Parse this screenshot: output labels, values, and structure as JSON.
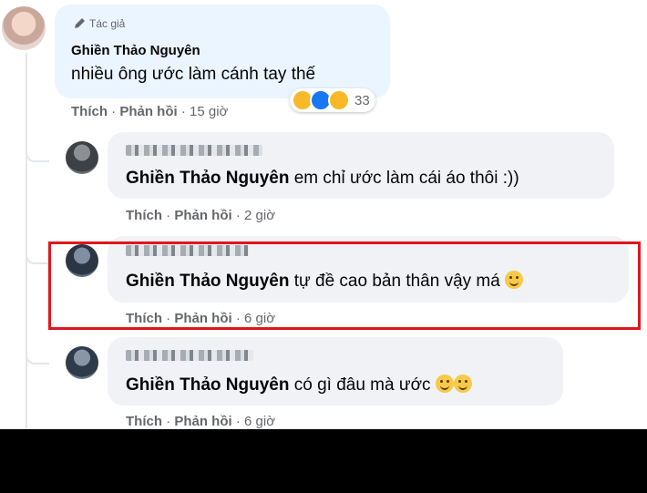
{
  "top_comment": {
    "badge": "Tác giả",
    "author": "Ghiền Thảo Nguyên",
    "text": "nhiều ông ước làm cánh tay thế",
    "like": "Thích",
    "reply": "Phản hồi",
    "time": "15 giờ",
    "reaction_count": "33",
    "reaction_icons": [
      "haha-icon",
      "like-icon",
      "care-icon"
    ]
  },
  "replies": [
    {
      "mention": "Ghiền Thảo Nguyên",
      "text": "em chỉ ước làm cái áo thôi :))",
      "like": "Thích",
      "reply": "Phản hồi",
      "time": "2 giờ",
      "emojis": 0
    },
    {
      "mention": "Ghiền Thảo Nguyên",
      "text": "tự đề cao bản thân vậy má",
      "like": "Thích",
      "reply": "Phản hồi",
      "time": "6 giờ",
      "emojis": 1
    },
    {
      "mention": "Ghiền Thảo Nguyên",
      "text": "có gì đâu mà ước",
      "like": "Thích",
      "reply": "Phản hồi",
      "time": "6 giờ",
      "emojis": 2
    }
  ],
  "colors": {
    "highlight": "#e0161d",
    "bubble": "#f0f2f5",
    "author_bubble": "#ebf5ff",
    "meta": "#65676b"
  }
}
